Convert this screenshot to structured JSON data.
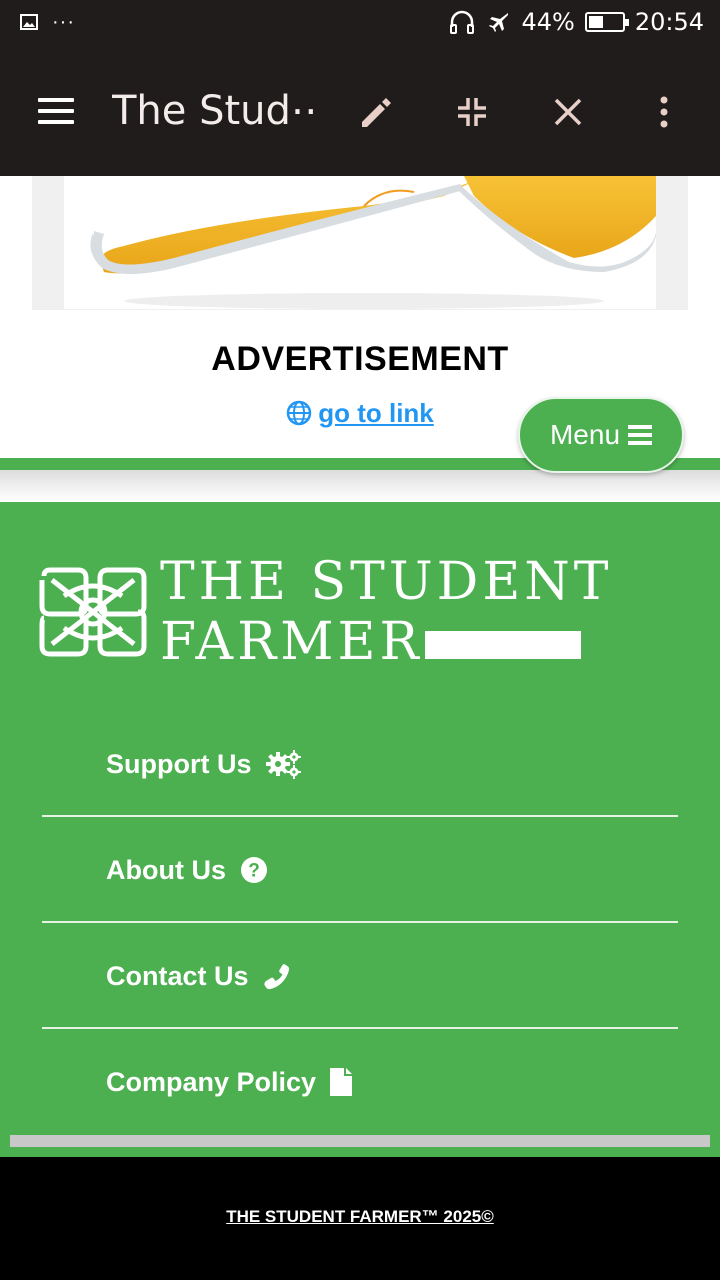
{
  "status_bar": {
    "battery_percent": "44%",
    "battery_level": 0.44,
    "time": "20:54",
    "icons": [
      "image-icon",
      "more-dots-icon",
      "headphones-icon",
      "airplane-icon",
      "battery-icon"
    ]
  },
  "toolbar": {
    "title": "The Stud⋯",
    "icons": [
      "hamburger-icon",
      "edit-pencil-icon",
      "collapse-icon",
      "close-icon",
      "overflow-menu-icon"
    ]
  },
  "ad": {
    "label": "ADVERTISEMENT",
    "link_text": "go to link",
    "link_icon": "globe-icon"
  },
  "menu_button": {
    "label": "Menu",
    "icon": "bars-icon"
  },
  "footer": {
    "logo": {
      "line1": "THE STUDENT",
      "line2": "FARMER"
    },
    "nav": [
      {
        "label": "Support Us",
        "icon": "cogs-icon"
      },
      {
        "label": "About Us",
        "icon": "question-circle-icon"
      },
      {
        "label": "Contact Us",
        "icon": "phone-icon"
      },
      {
        "label": "Company Policy",
        "icon": "file-icon"
      }
    ],
    "copyright": "THE STUDENT FARMER™ 2025©"
  },
  "colors": {
    "status_bar_bg": "#201c1b",
    "footer_green": "#4caf50",
    "link_blue": "#2196f3",
    "shoe_yellow": "#f5b52a"
  }
}
